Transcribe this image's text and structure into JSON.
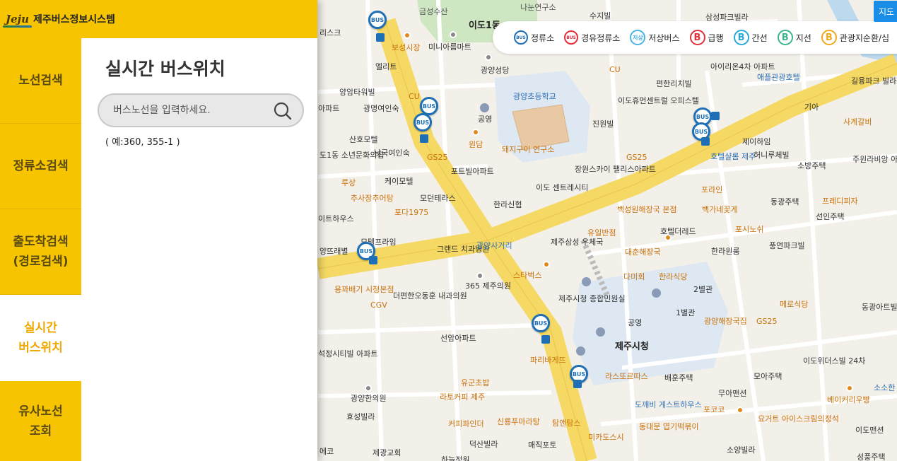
{
  "header": {
    "logo_mark": "Jeju",
    "title": "제주버스정보시스템"
  },
  "nav": [
    {
      "label": "노선검색",
      "active": false
    },
    {
      "label": "정류소검색",
      "active": false
    },
    {
      "label": "출도착검색\n(경로검색)",
      "active": false
    },
    {
      "label": "실시간\n버스위치",
      "active": true
    },
    {
      "label": "유사노선\n조회",
      "active": false
    }
  ],
  "content": {
    "title": "실시간 버스위치",
    "search_placeholder": "버스노선을 입력하세요.",
    "example": "( 예:360, 355-1 )"
  },
  "map_button": {
    "label": "지도"
  },
  "legend": {
    "stop": "정류소",
    "via_stop": "경유정류소",
    "low_floor": "저상버스",
    "low_floor_badge": "저상",
    "express": "급행",
    "trunk": "간선",
    "branch": "지선",
    "tour": "관광지순환/심",
    "bus_badge": "BUS",
    "b_letter": "B",
    "colors": {
      "stop": "#1e6fb5",
      "via_stop": "#e0303a",
      "low_floor": "#4ab3e6",
      "express": "#e0303a",
      "trunk": "#29a8dc",
      "branch": "#3cb58a",
      "tour": "#f2a81d"
    }
  },
  "map": {
    "bus_badge": "BUS",
    "labels": [
      "금성수산",
      "이도1동",
      "나눈연구소",
      "수지빌",
      "삼성파크빌라",
      "리스크",
      "보성시장",
      "미니아름마트",
      "엘리트",
      "광양성당",
      "광양초등학교",
      "양암타워빌",
      "CU",
      "광명여인숙",
      "아파트",
      "공영",
      "산호모텔",
      "남국여인숙",
      "원담",
      "돼지구이\n연구소",
      "도1동\n소년문화의집",
      "GS25",
      "케이모텔",
      "포트빌아파트",
      "루상",
      "추사장추어탕",
      "모던테라스",
      "한라신협",
      "포다1975",
      "이트하우스",
      "모텔프라임",
      "양뜨래별",
      "그랜드\n치과병원",
      "광양사거리",
      "용꽈배기\n시청본점",
      "CGV",
      "더편한오동훈\n내과의원",
      "365\n제주의원",
      "선암아파트",
      "석정시티빌\n아파트",
      "광양한의원",
      "효성빌라",
      "제광교회",
      "유군초밥",
      "라토커피\n제주",
      "커피파인더",
      "신룡푸마라탕",
      "덕산빌라",
      "매직포토",
      "파리바게뜨",
      "탐앤탐스",
      "미카도스시",
      "CU",
      "편한리치빌",
      "아이리온4차\n아파트",
      "이도휴먼센트럴\n오피스텔",
      "진원빌",
      "장원스카이\n팰리스아파트",
      "이도\n센트레시티",
      "GS25",
      "백성원해장국\n본점",
      "유일반점",
      "제주삼성\n우체국",
      "대춘해장국",
      "다미회",
      "한라식당",
      "스타벅스",
      "제주시청\n종합민원실",
      "공영",
      "제주시청",
      "라스또르따스",
      "배훈주택",
      "도깨비\n게스트하우스",
      "동대문\n엽기떡볶이",
      "호텔더레드",
      "한라원룸",
      "2별관",
      "1별관",
      "광양해장국집",
      "GS25",
      "애플관광호텔",
      "길융파크\n빌라트",
      "기아",
      "사계갈비",
      "제이하임",
      "호텔샬롬\n제주",
      "허니루체빌",
      "소방주택",
      "주원라비앙\n아파트",
      "포라인",
      "백가네꽃게",
      "동광주택",
      "프레디피자",
      "선인주택",
      "포시노쉬",
      "풍연파크빌",
      "메로식당",
      "동광아트빌",
      "이도위더스빌\n24차",
      "모아주택",
      "무아맨션",
      "소소한",
      "베이커리우빵",
      "포코코",
      "요거트\n아이스크림의정석",
      "이도맨션",
      "소양빌라",
      "성풍주택",
      "하늘정원",
      "에코"
    ]
  }
}
